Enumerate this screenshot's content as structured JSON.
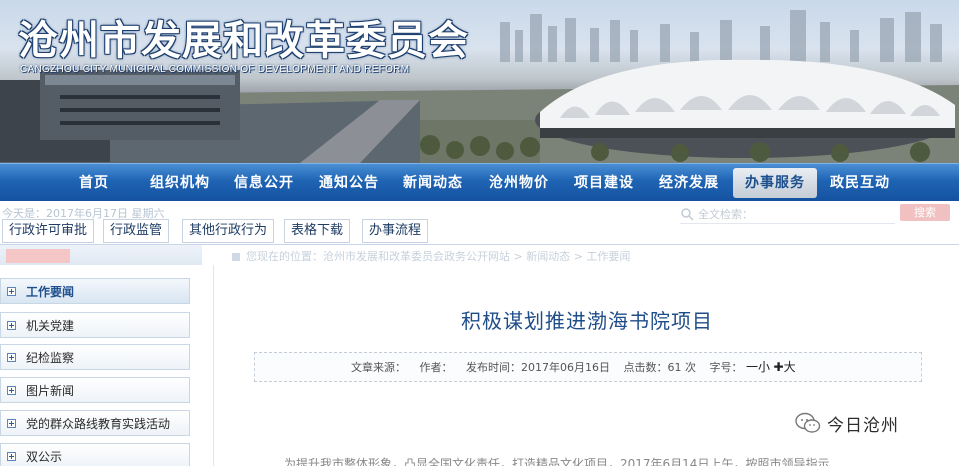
{
  "banner": {
    "title": "沧州市发展和改革委员会",
    "subtitle": "CANGZHOU CITY MUNICIPAL COMMISSION OF DEVELOPMENT AND REFORM"
  },
  "nav": {
    "items": [
      {
        "label": "首页"
      },
      {
        "label": "组织机构"
      },
      {
        "label": "信息公开"
      },
      {
        "label": "通知公告"
      },
      {
        "label": "新闻动态"
      },
      {
        "label": "沧州物价"
      },
      {
        "label": "项目建设"
      },
      {
        "label": "经济发展"
      },
      {
        "label": "办事服务"
      },
      {
        "label": "政民互动"
      }
    ],
    "active_label": "办事服务"
  },
  "subbar": {
    "date_text": "今天是：2017年6月17日 星期六",
    "search_placeholder": "全文检索：",
    "search_button": "搜索",
    "tabs": [
      {
        "label": "行政许可审批"
      },
      {
        "label": "行政监管"
      },
      {
        "label": "其他行政行为"
      },
      {
        "label": "表格下载"
      },
      {
        "label": "办事流程"
      }
    ]
  },
  "breadcrumb": {
    "text": "您现在的位置：沧州市发展和改革委员会政务公开网站 > 新闻动态 > 工作要闻"
  },
  "sidebar": {
    "items": [
      {
        "label": "工作要闻"
      },
      {
        "label": "机关党建"
      },
      {
        "label": "纪检监察"
      },
      {
        "label": "图片新闻"
      },
      {
        "label": "党的群众路线教育实践活动"
      },
      {
        "label": "双公示"
      }
    ]
  },
  "article": {
    "title": "积极谋划推进渤海书院项目",
    "meta": {
      "source_label": "文章来源：",
      "author_label": "作者：",
      "published_label": "发布时间：",
      "published_value": "2017年06月16日",
      "clicks_label": "点击数：",
      "clicks_value": "61",
      "clicks_unit": "次",
      "fontsize_label": "字号：",
      "font_small": "一小",
      "font_large": "✚大"
    },
    "body_preview": "为提升我市整体形象，凸显全国文化责任，打造精品文化项目，2017年6月14日上午，按照市领导指示"
  },
  "watermark": {
    "text": "今日沧州"
  }
}
